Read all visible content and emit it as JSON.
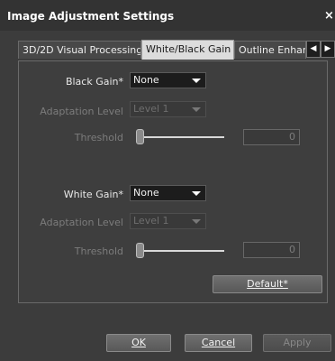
{
  "window": {
    "title": "Image Adjustment Settings",
    "close_glyph": "×"
  },
  "tabs": [
    {
      "label": "3D/2D Visual Processing",
      "active": false
    },
    {
      "label": "White/Black Gain",
      "active": true
    },
    {
      "label": "Outline Enhan",
      "active": false
    }
  ],
  "tab_scroll": {
    "left_glyph": "◀",
    "right_glyph": "▶"
  },
  "black": {
    "gain_label": "Black Gain*",
    "gain_value": "None",
    "adaptation_label": "Adaptation Level",
    "adaptation_value": "Level 1",
    "threshold_label": "Threshold",
    "threshold_value": "0"
  },
  "white": {
    "gain_label": "White Gain*",
    "gain_value": "None",
    "adaptation_label": "Adaptation Level",
    "adaptation_value": "Level 1",
    "threshold_label": "Threshold",
    "threshold_value": "0"
  },
  "buttons": {
    "default_label": "Default*",
    "ok_label": "OK",
    "cancel_label": "Cancel",
    "apply_label": "Apply"
  },
  "icons": {
    "close": "close-icon",
    "dropdown": "chevron-down-icon",
    "scroll_left": "arrow-left-icon",
    "scroll_right": "arrow-right-icon"
  }
}
